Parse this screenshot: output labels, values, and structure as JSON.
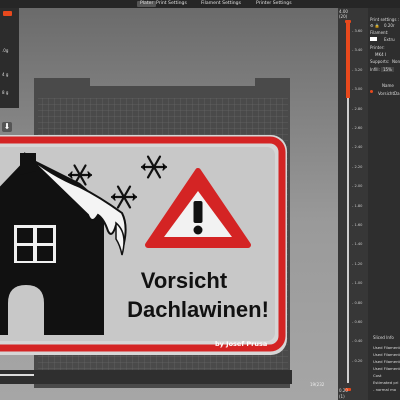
{
  "tabs": [
    "Plater",
    "Print Settings",
    "Filament Settings",
    "Printer Settings"
  ],
  "left_panel": {
    "values": [
      ".0g",
      "4 g",
      "8 g"
    ]
  },
  "plate": {
    "sign_line1": "Vorsicht",
    "sign_line2": "Dachlawinen!",
    "credit": "by Josef Prusa",
    "bottom_readout": "19(232"
  },
  "slider": {
    "top_value": "4.00",
    "top_layer": "(20)",
    "bottom_value": "0.20",
    "bottom_layer": "(1)",
    "ticks": [
      "3.60",
      "3.40",
      "3.20",
      "3.00",
      "2.80",
      "2.60",
      "2.40",
      "2.20",
      "2.00",
      "1.80",
      "1.60",
      "1.40",
      "1.20",
      "1.00",
      "0.80",
      "0.60",
      "0.40",
      "0.20"
    ],
    "accent": "#e8491d"
  },
  "right_panel": {
    "print_settings_label": "Print settings :",
    "print_settings_value": "0.20r",
    "filament_label": "Filament:",
    "filament_value": "Extru",
    "printer_label": "Printer:",
    "printer_value": "MK4 I",
    "supports_label": "Supports:",
    "supports_value": "Non",
    "infill_label": "Infill:",
    "infill_value": "15%",
    "list_header": "Name",
    "list_item": "VorsichtDa",
    "info_title": "Sliced Info",
    "info_lines": [
      "Used Filament",
      "Used Filament",
      "Used Filament",
      "Used Filament",
      "Cost",
      "Estimated pri",
      "- normal mo"
    ]
  }
}
